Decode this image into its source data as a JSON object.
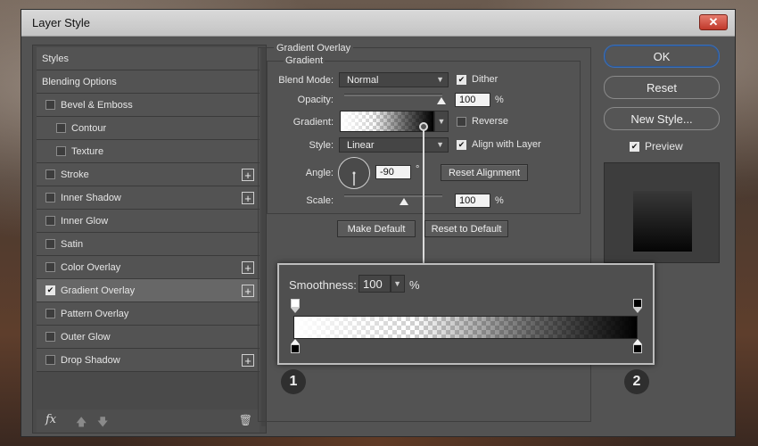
{
  "window": {
    "title": "Layer Style",
    "close_glyph": "✕"
  },
  "styles_panel": {
    "items": [
      {
        "label": "Styles",
        "checkbox": false,
        "checked": false,
        "plus": false,
        "indent": false,
        "selected": false
      },
      {
        "label": "Blending Options",
        "checkbox": false,
        "checked": false,
        "plus": false,
        "indent": false,
        "selected": false
      },
      {
        "label": "Bevel & Emboss",
        "checkbox": true,
        "checked": false,
        "plus": false,
        "indent": false,
        "selected": false
      },
      {
        "label": "Contour",
        "checkbox": true,
        "checked": false,
        "plus": false,
        "indent": true,
        "selected": false
      },
      {
        "label": "Texture",
        "checkbox": true,
        "checked": false,
        "plus": false,
        "indent": true,
        "selected": false
      },
      {
        "label": "Stroke",
        "checkbox": true,
        "checked": false,
        "plus": true,
        "indent": false,
        "selected": false
      },
      {
        "label": "Inner Shadow",
        "checkbox": true,
        "checked": false,
        "plus": true,
        "indent": false,
        "selected": false
      },
      {
        "label": "Inner Glow",
        "checkbox": true,
        "checked": false,
        "plus": false,
        "indent": false,
        "selected": false
      },
      {
        "label": "Satin",
        "checkbox": true,
        "checked": false,
        "plus": false,
        "indent": false,
        "selected": false
      },
      {
        "label": "Color Overlay",
        "checkbox": true,
        "checked": false,
        "plus": true,
        "indent": false,
        "selected": false
      },
      {
        "label": "Gradient Overlay",
        "checkbox": true,
        "checked": true,
        "plus": true,
        "indent": false,
        "selected": true
      },
      {
        "label": "Pattern Overlay",
        "checkbox": true,
        "checked": false,
        "plus": false,
        "indent": false,
        "selected": false
      },
      {
        "label": "Outer Glow",
        "checkbox": true,
        "checked": false,
        "plus": false,
        "indent": false,
        "selected": false
      },
      {
        "label": "Drop Shadow",
        "checkbox": true,
        "checked": false,
        "plus": true,
        "indent": false,
        "selected": false
      }
    ],
    "footer": {
      "fx": "fx",
      "up_glyph": "🡅",
      "down_glyph": "🡇",
      "trash_glyph": "🗑"
    }
  },
  "gradient_overlay": {
    "group_title": "Gradient Overlay",
    "subgroup_title": "Gradient",
    "blend_mode": {
      "label": "Blend Mode:",
      "value": "Normal"
    },
    "dither": {
      "label": "Dither",
      "checked": true
    },
    "opacity": {
      "label": "Opacity:",
      "value": "100",
      "unit": "%",
      "level": 1.0
    },
    "gradient": {
      "label": "Gradient:"
    },
    "reverse": {
      "label": "Reverse",
      "checked": false
    },
    "style": {
      "label": "Style:",
      "value": "Linear"
    },
    "align_with_layer": {
      "label": "Align with Layer",
      "checked": true
    },
    "angle": {
      "label": "Angle:",
      "value": "-90",
      "unit": "°",
      "degrees": -90
    },
    "reset_alignment": "Reset Alignment",
    "scale": {
      "label": "Scale:",
      "value": "100",
      "unit": "%",
      "level": 0.6
    },
    "make_default": "Make Default",
    "reset_to_default": "Reset to Default"
  },
  "right_column": {
    "ok": "OK",
    "reset": "Reset",
    "new_style": "New Style...",
    "preview": {
      "label": "Preview",
      "checked": true
    }
  },
  "gradient_editor": {
    "smoothness_label": "Smoothness:",
    "smoothness_value": "100",
    "smoothness_unit": "%",
    "marker_1": "1",
    "marker_2": "2"
  },
  "colors": {
    "dialog_bg": "#535353",
    "selected_item": "#676767",
    "ok_outline": "#3e6fb3"
  }
}
